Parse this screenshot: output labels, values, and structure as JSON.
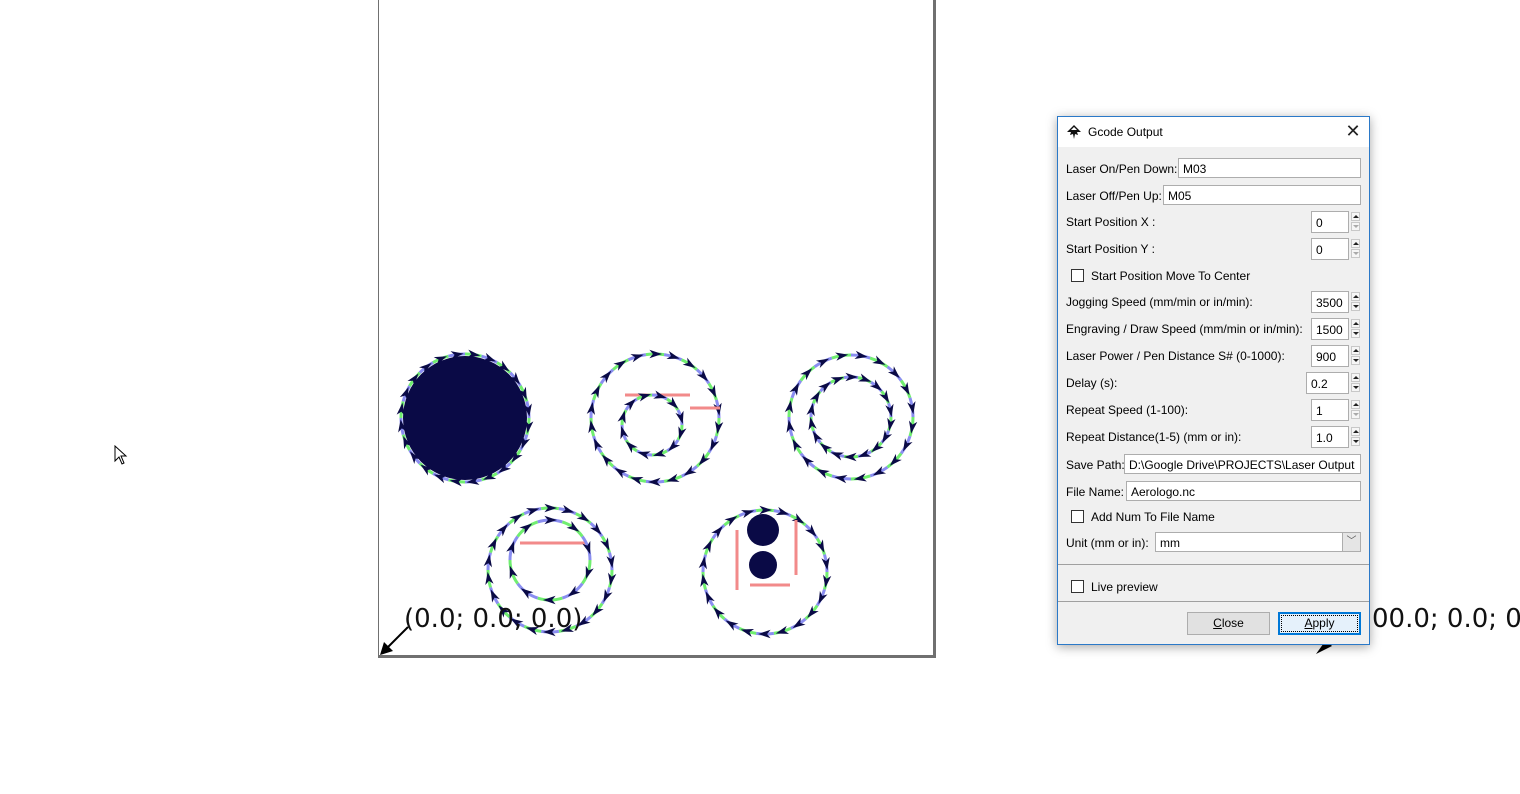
{
  "canvas": {
    "origin_label": "(0.0; 0.0; 0.0)",
    "secondary_label": "00.0; 0.0; 0",
    "colors": {
      "arrow": "#0a0a46",
      "cut_green": "#70ee70",
      "cut_blue": "#8a8ef0",
      "travel_red": "#f28a8a",
      "page_border": "#707070"
    }
  },
  "dialog": {
    "title": "Gcode Output",
    "fields": {
      "laser_on": {
        "label": "Laser On/Pen Down:",
        "value": "M03"
      },
      "laser_off": {
        "label": "Laser Off/Pen Up:",
        "value": "M05"
      },
      "start_x": {
        "label": "Start Position X :",
        "value": "0"
      },
      "start_y": {
        "label": "Start Position Y :",
        "value": "0"
      },
      "move_center": {
        "label": "Start Position Move To Center",
        "checked": false
      },
      "jog_speed": {
        "label": "Jogging Speed (mm/min or in/min):",
        "value": "3500"
      },
      "draw_speed": {
        "label": "Engraving / Draw Speed (mm/min or in/min):",
        "value": "1500"
      },
      "laser_power": {
        "label": "Laser Power / Pen Distance S# (0-1000):",
        "value": "900"
      },
      "delay": {
        "label": "Delay (s):",
        "value": "0.2"
      },
      "repeat_speed": {
        "label": "Repeat Speed (1-100):",
        "value": "1"
      },
      "repeat_distance": {
        "label": "Repeat Distance(1-5) (mm or in):",
        "value": "1.0"
      },
      "save_path": {
        "label": "Save Path:",
        "value": "D:\\Google Drive\\PROJECTS\\Laser Output"
      },
      "file_name": {
        "label": "File Name:",
        "value": "Aerologo.nc"
      },
      "add_num": {
        "label": "Add Num To File Name",
        "checked": false
      },
      "unit": {
        "label": "Unit (mm or in):",
        "value": "mm"
      },
      "live_preview": {
        "label": "Live preview",
        "checked": false
      }
    },
    "buttons": {
      "close_access": "C",
      "close_rest": "lose",
      "apply_access": "A",
      "apply_rest": "pply"
    }
  }
}
